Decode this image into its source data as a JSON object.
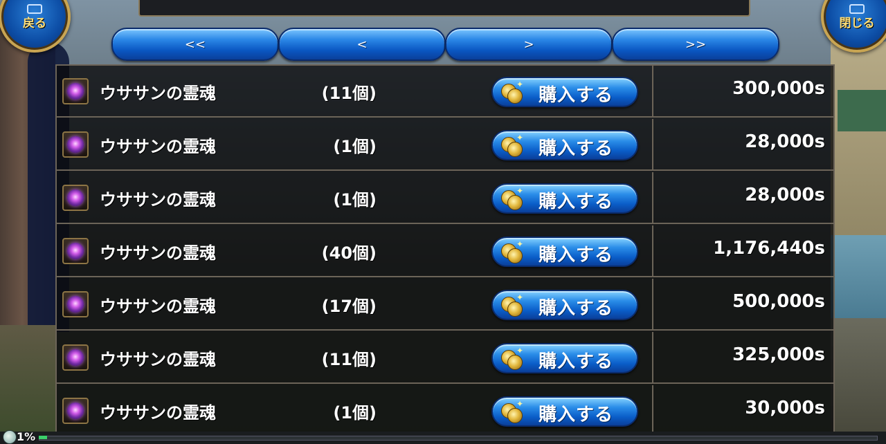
{
  "header": {
    "back_label": "戻る",
    "close_label": "閉じる"
  },
  "pager": {
    "first": "<<",
    "prev": "<",
    "next": ">",
    "last": ">>"
  },
  "listings": [
    {
      "name": "ウササンの霊魂",
      "quantity": "(11個)",
      "buy_label": "購入する",
      "price": "300,000s"
    },
    {
      "name": "ウササンの霊魂",
      "quantity": "(1個)",
      "buy_label": "購入する",
      "price": "28,000s"
    },
    {
      "name": "ウササンの霊魂",
      "quantity": "(1個)",
      "buy_label": "購入する",
      "price": "28,000s"
    },
    {
      "name": "ウササンの霊魂",
      "quantity": "(40個)",
      "buy_label": "購入する",
      "price": "1,176,440s"
    },
    {
      "name": "ウササンの霊魂",
      "quantity": "(17個)",
      "buy_label": "購入する",
      "price": "500,000s"
    },
    {
      "name": "ウササンの霊魂",
      "quantity": "(11個)",
      "buy_label": "購入する",
      "price": "325,000s"
    },
    {
      "name": "ウササンの霊魂",
      "quantity": "(1個)",
      "buy_label": "購入する",
      "price": "30,000s"
    }
  ],
  "status": {
    "progress_text": "1%",
    "progress_fraction": 0.01
  },
  "icons": {
    "item": "purple-orb-icon",
    "buy": "coins-icon"
  }
}
